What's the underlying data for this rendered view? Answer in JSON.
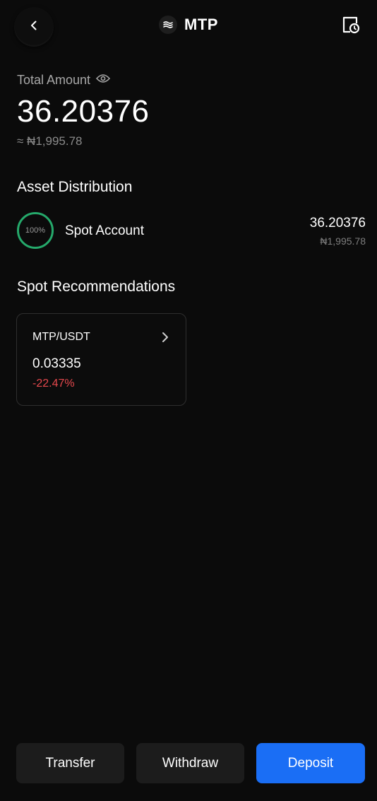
{
  "header": {
    "coin_name": "MTP",
    "logo_icon": "layers-icon",
    "back_icon": "chevron-left-icon",
    "history_icon": "document-clock-icon"
  },
  "summary": {
    "total_label": "Total Amount",
    "visibility_icon": "eye-icon",
    "total_amount": "36.20376",
    "total_fiat": "≈ ₦1,995.78"
  },
  "asset_distribution": {
    "title": "Asset Distribution",
    "items": [
      {
        "percent_label": "100%",
        "percent_value": 100,
        "name": "Spot Account",
        "amount": "36.20376",
        "fiat": "₦1,995.78",
        "ring_color": "#25a96b"
      }
    ]
  },
  "spot_recommendations": {
    "title": "Spot Recommendations",
    "cards": [
      {
        "pair": "MTP/USDT",
        "price": "0.03335",
        "change": "-22.47%",
        "change_color": "#e5484d",
        "chevron_icon": "chevron-right-icon"
      }
    ]
  },
  "actions": {
    "transfer_label": "Transfer",
    "withdraw_label": "Withdraw",
    "deposit_label": "Deposit",
    "deposit_color": "#1a6ef5"
  }
}
